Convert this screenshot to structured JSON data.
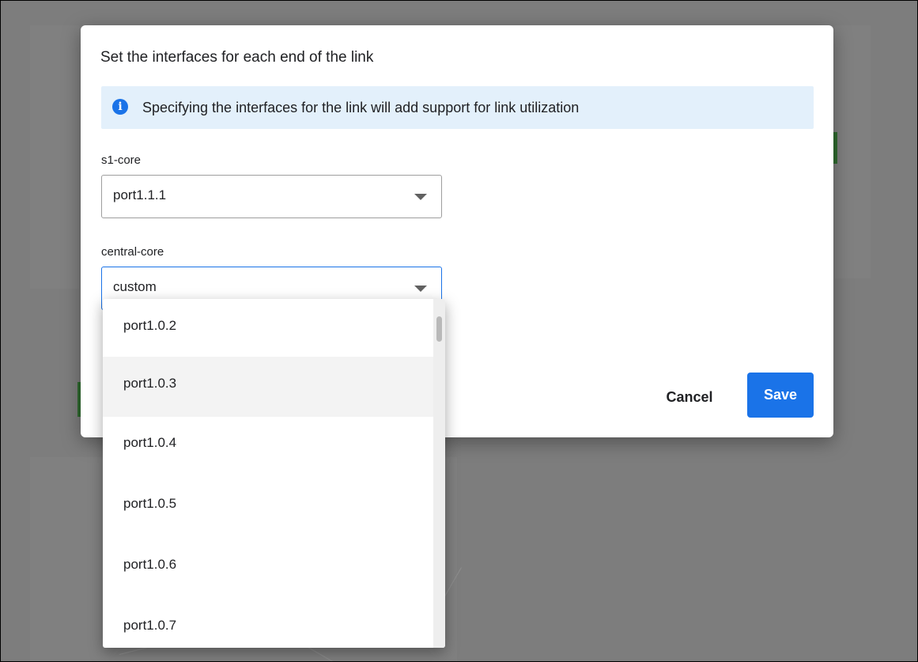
{
  "dialog": {
    "title": "Set the interfaces for each end of the link",
    "info": {
      "icon": "info-icon",
      "text": "Specifying the interfaces for the link will add support for link utilization"
    },
    "fields": [
      {
        "label": "s1-core",
        "value": "port1.1.1"
      },
      {
        "label": "central-core",
        "value": "custom"
      }
    ],
    "actions": {
      "cancel": "Cancel",
      "save": "Save"
    }
  },
  "dropdown": {
    "options": [
      "port1.0.2",
      "port1.0.3",
      "port1.0.4",
      "port1.0.5",
      "port1.0.6",
      "port1.0.7"
    ],
    "hovered_option": "port1.0.3"
  },
  "colors": {
    "accent": "#1a73e8",
    "info_background": "#e3f0fb",
    "overlay": "#7d7d7d"
  }
}
